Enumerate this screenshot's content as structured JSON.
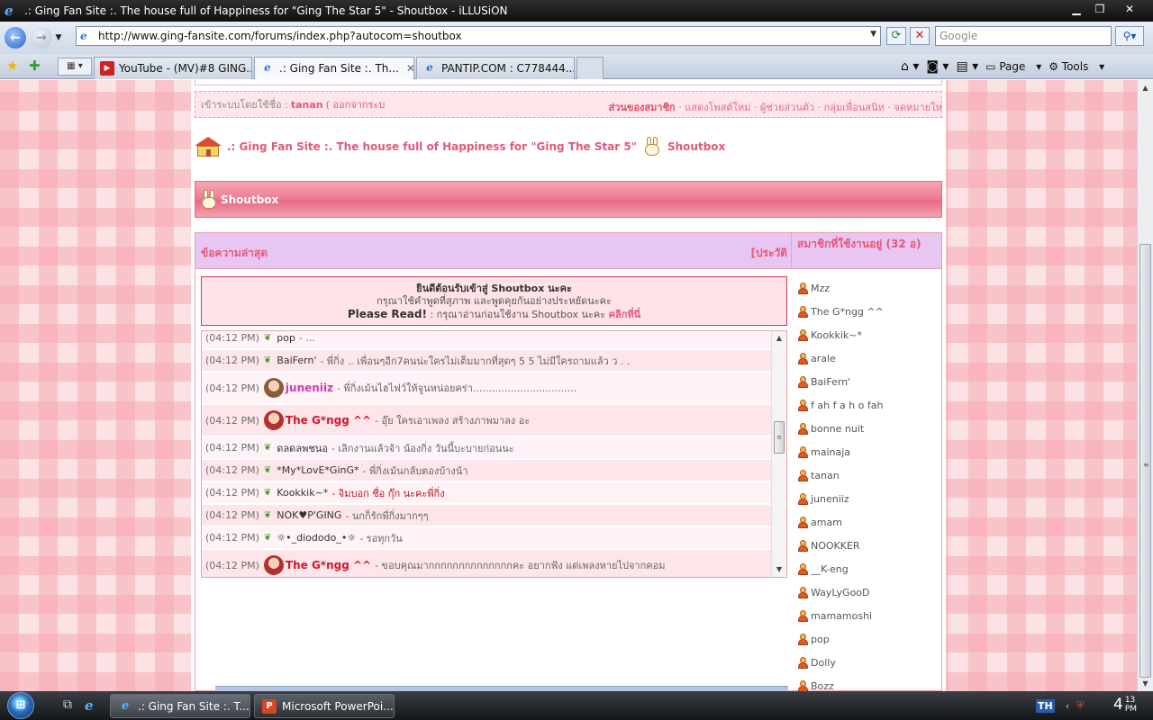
{
  "window": {
    "title": ".: Ging Fan Site :. The house full of Happiness for \"Ging The Star 5\" - Shoutbox - iLLUSiON",
    "controls": {
      "minimize": "▁",
      "maximize": "❐",
      "close": "✕"
    }
  },
  "address_bar": {
    "url": "http://www.ging-fansite.com/forums/index.php?autocom=shoutbox",
    "search_placeholder": "Google"
  },
  "tabs": [
    {
      "label": "YouTube - (MV)#8 GING...",
      "icon": "youtube-icon",
      "active": false
    },
    {
      "label": ".: Ging Fan Site :. Th...",
      "icon": "ie-icon",
      "active": true
    },
    {
      "label": "PANTIP.COM : C778444...",
      "icon": "ie-icon",
      "active": false
    }
  ],
  "command_bar": {
    "page_label": "Page",
    "tools_label": "Tools"
  },
  "user_bar": {
    "login_prefix": "เข้าระบบโดยใช้ชื่อ :",
    "username": "tanan",
    "logout_label": "( ออกจากระบ",
    "my_controls": "ส่วนของสมาชิก",
    "links": "· แสดงโพสต์ใหม่ · ผู้ช่วยส่วนตัว · กลุ่มเพื่อนสนิท · จดหมายใหม่"
  },
  "breadcrumb": {
    "site": ".: Ging Fan Site :. The house full of Happiness for \"Ging The Star 5\"",
    "current": "Shoutbox"
  },
  "category": {
    "title": "Shoutbox"
  },
  "shoutbox": {
    "latest_label": "ข้อความล่าสุด",
    "history_label": "[ประวัติ",
    "welcome": {
      "line1": "ยินดีต้อนรับเข้าสู่ Shoutbox นะคะ",
      "line2": "กรุณาใช้คำพูดที่สุภาพ และพูดคุยกันอย่างประหยัดนะคะ",
      "please_read": "Please Read!",
      "line3": ": กรุณาอ่านก่อนใช้งาน Shoutbox นะคะ",
      "click_here": "คลิกที่นี่"
    },
    "messages": [
      {
        "time": "(04:12 PM)",
        "nick": "pop",
        "text": "- ...",
        "style": "plain",
        "avatar": false
      },
      {
        "time": "(04:12 PM)",
        "nick": "BaiFern'",
        "text": "- พี่กิ่ง .. เพื่อนๆอีก7คนน่ะใครไม่เต็มมากที่สุดๆ 5 5 ไม่มีใครถามแล้ว ว . .",
        "style": "plain",
        "avatar": false
      },
      {
        "time": "(04:12 PM)",
        "nick": "juneniiz",
        "text": "- พี่กิ่งเม้นไฮไฟว์ให้จูนหน่อยคร่า.................................",
        "style": "pink",
        "avatar": true
      },
      {
        "time": "(04:12 PM)",
        "nick": "The G*ngg ^^",
        "text": "- อุ๊ย ใครเอาเพลง สร้างภาพมาลง อะ",
        "style": "big",
        "avatar": true
      },
      {
        "time": "(04:12 PM)",
        "nick": "ดลดลพชนอ",
        "text": "- เลิกงานแล้วจ้า น้องกิ่ง วันนี้บะบายก่อนนะ",
        "style": "plain",
        "avatar": false
      },
      {
        "time": "(04:12 PM)",
        "nick": "*My*LovE*GinG*",
        "text": "- พี่กิ่งเม้นกลับตองบ้างน้า",
        "style": "plain",
        "avatar": false
      },
      {
        "time": "(04:12 PM)",
        "nick": "Kookkik~*",
        "text": "- จิมบอก ชื่อ กุ๊ก นะคะพี่กิ่ง",
        "style": "plain-redtext",
        "avatar": false
      },
      {
        "time": "(04:12 PM)",
        "nick": "NOK♥P'GING",
        "text": "- นกก็รักพี่กิ่งมากๆๆ",
        "style": "plain",
        "avatar": false
      },
      {
        "time": "(04:12 PM)",
        "nick": "☼•_diododo_•☼",
        "text": "- รอทุกวัน",
        "style": "plain",
        "avatar": false
      },
      {
        "time": "(04:12 PM)",
        "nick": "The G*ngg ^^",
        "text": "- ขอบคุณมากกกกกกกกกกกกกกคะ อยากฟัง แต่เพลงหายไปจากคอม",
        "style": "big",
        "avatar": true
      },
      {
        "time": "(04:12 PM)",
        "nick": "...",
        "text": "",
        "style": "plain",
        "avatar": false
      }
    ]
  },
  "online": {
    "title": "สมาชิกที่ใช้งานอยู่ (32 อ)",
    "users": [
      "Mzz",
      "The G*ngg ^^",
      "Kookkik~*",
      "arale",
      "BaiFern'",
      "f ah f a h o fah",
      "bonne nuit",
      "mainaja",
      "tanan",
      "juneniiz",
      "amam",
      "NOOKKER",
      "__K-eng",
      "WayLyGooD",
      "mamamoshi",
      "pop",
      "Dolly",
      "Bozz"
    ]
  },
  "taskbar": {
    "buttons": [
      {
        "label": ".: Ging Fan Site :. T...",
        "icon": "ie-icon",
        "active": true
      },
      {
        "label": "Microsoft PowerPoi...",
        "icon": "powerpoint-icon",
        "active": false
      }
    ],
    "language": "TH",
    "clock_hour": "4",
    "clock_min": "13",
    "clock_ampm": "PM"
  }
}
